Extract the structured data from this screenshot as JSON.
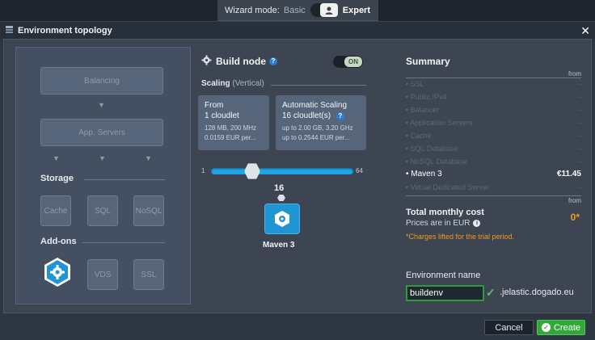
{
  "wizard": {
    "label": "Wizard mode:",
    "basic": "Basic",
    "expert": "Expert"
  },
  "dialog": {
    "title": "Environment topology",
    "close": "✕"
  },
  "topology": {
    "balancing": "Balancing",
    "app_servers": "App. Servers",
    "storage_title": "Storage",
    "storage": [
      "Cache",
      "SQL",
      "NoSQL"
    ],
    "addons_title": "Add-ons",
    "addons": [
      "VDS",
      "SSL"
    ]
  },
  "build_node": {
    "title": "Build node",
    "toggle": "ON",
    "scaling": "Scaling",
    "scaling_mode": "(Vertical)",
    "from_card": {
      "title": "From",
      "value": "1 cloudlet",
      "line1": "128 MB, 200 MHz",
      "line2": "0.0159 EUR per..."
    },
    "auto_card": {
      "title": "Automatic Scaling",
      "value": "16 cloudlet(s)",
      "line1": "up to 2.00 GB, 3.20 GHz",
      "line2": "up to 0.2544 EUR per..."
    },
    "slider": {
      "min": "1",
      "max": "64",
      "value_fraction": 0.22
    },
    "count": "16",
    "node_label": "Maven 3"
  },
  "summary": {
    "title": "Summary",
    "from": "from",
    "rows": [
      {
        "name": "SSL",
        "price": "-"
      },
      {
        "name": "Public IPv4",
        "price": "-"
      },
      {
        "name": "Balancer",
        "price": "-"
      },
      {
        "name": "Application Servers",
        "price": "-"
      },
      {
        "name": "Cache",
        "price": "-"
      },
      {
        "name": "SQL Database",
        "price": "-"
      },
      {
        "name": "NoSQL Database",
        "price": "-"
      },
      {
        "name": "Maven 3",
        "price": "€11.45"
      },
      {
        "name": "Virtual Dedicated Server",
        "price": "-"
      }
    ],
    "total_title": "Total monthly cost",
    "total_value": "0*",
    "price_note": "Prices are in EUR",
    "charges": "*Charges lifted for the trial period."
  },
  "env": {
    "label": "Environment name",
    "value": "buildenv",
    "suffix": ".jelastic.dogado.eu"
  },
  "footer": {
    "cancel": "Cancel",
    "create": "Create"
  },
  "colors": {
    "accent": "#20a6e6",
    "create": "#32a83a",
    "cost": "#f29a1b"
  }
}
